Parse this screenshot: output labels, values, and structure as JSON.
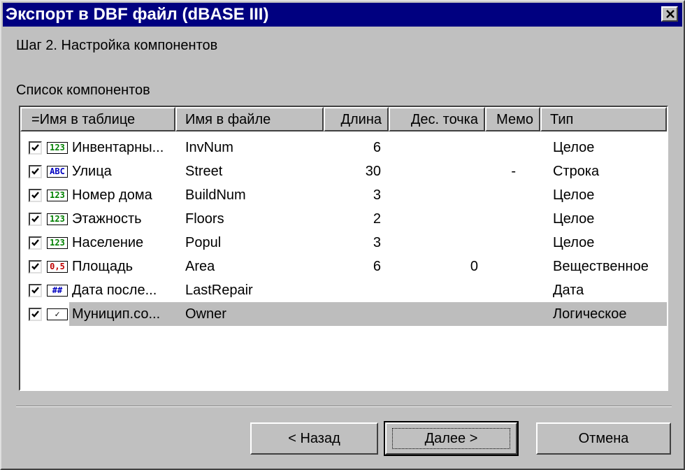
{
  "window": {
    "title": "Экспорт в DBF файл (dBASE III)"
  },
  "step_label": "Шаг 2. Настройка компонентов",
  "list_label": "Список компонентов",
  "columns": [
    "=Имя в таблице",
    "Имя в файле",
    "Длина",
    "Дес. точка",
    "Мемо",
    "Тип"
  ],
  "rows": [
    {
      "checked": true,
      "type_icon": "integer-type-icon",
      "icon_text": "123",
      "table_name": "Инвентарны...",
      "file_name": "InvNum",
      "length": "6",
      "decimal": "",
      "memo": "",
      "type": "Целое"
    },
    {
      "checked": true,
      "type_icon": "string-type-icon",
      "icon_text": "ABC",
      "table_name": "Улица",
      "file_name": "Street",
      "length": "30",
      "decimal": "",
      "memo": "-",
      "type": "Строка"
    },
    {
      "checked": true,
      "type_icon": "integer-type-icon",
      "icon_text": "123",
      "table_name": "Номер дома",
      "file_name": "BuildNum",
      "length": "3",
      "decimal": "",
      "memo": "",
      "type": "Целое"
    },
    {
      "checked": true,
      "type_icon": "integer-type-icon",
      "icon_text": "123",
      "table_name": "Этажность",
      "file_name": "Floors",
      "length": "2",
      "decimal": "",
      "memo": "",
      "type": "Целое"
    },
    {
      "checked": true,
      "type_icon": "integer-type-icon",
      "icon_text": "123",
      "table_name": "Население",
      "file_name": "Popul",
      "length": "3",
      "decimal": "",
      "memo": "",
      "type": "Целое"
    },
    {
      "checked": true,
      "type_icon": "real-type-icon",
      "icon_text": "0,5",
      "table_name": "Площадь",
      "file_name": "Area",
      "length": "6",
      "decimal": "0",
      "memo": "",
      "type": "Вещественное"
    },
    {
      "checked": true,
      "type_icon": "date-type-icon",
      "icon_text": "##",
      "table_name": "Дата после...",
      "file_name": "LastRepair",
      "length": "",
      "decimal": "",
      "memo": "",
      "type": "Дата"
    },
    {
      "checked": true,
      "type_icon": "boolean-type-icon",
      "icon_text": "✓",
      "table_name": "Муницип.со...",
      "file_name": "Owner",
      "length": "",
      "decimal": "",
      "memo": "",
      "type": "Логическое",
      "selected": true
    }
  ],
  "buttons": {
    "back": "< Назад",
    "next": "Далее >",
    "cancel": "Отмена"
  },
  "colors": {
    "titlebar": "#000080",
    "face": "#c0c0c0",
    "selection": "#bdbdbd",
    "integer_icon": "#008000",
    "string_icon": "#0000c0",
    "real_icon": "#c00000"
  }
}
